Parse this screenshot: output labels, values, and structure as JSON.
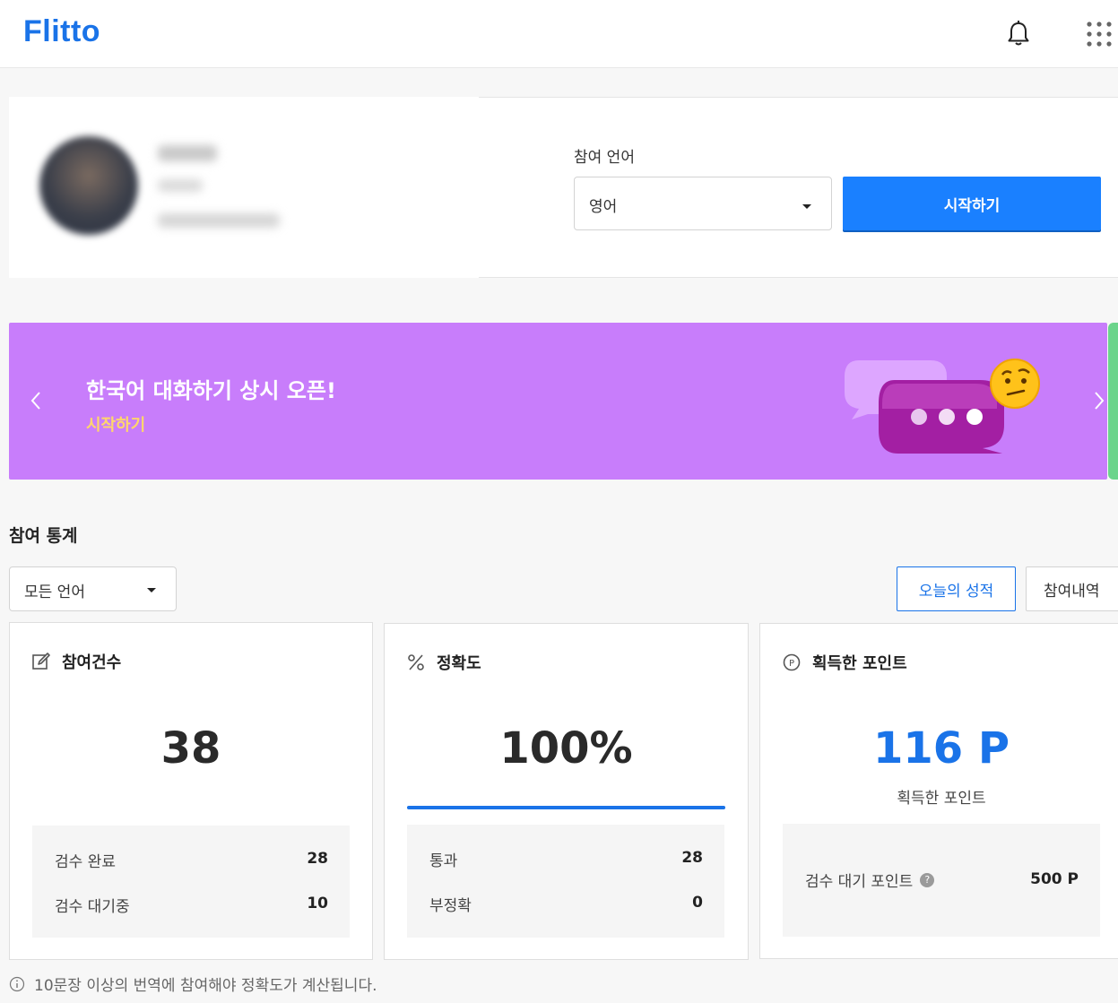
{
  "header": {
    "logo": "Flitto",
    "icons": [
      "bell-icon",
      "apps-grid-icon"
    ]
  },
  "language_panel": {
    "label": "참여 언어",
    "selected_language": "영어",
    "start_button": "시작하기"
  },
  "banner": {
    "title": "한국어 대화하기 상시 오픈!",
    "link": "시작하기",
    "background_color": "#c87dfb",
    "link_color": "#ffd66b"
  },
  "stats": {
    "section_title": "참여 통계",
    "language_filter": "모든 언어",
    "tabs": {
      "today": "오늘의 성적",
      "history": "참여내역"
    },
    "participation": {
      "title": "참여건수",
      "value": "38",
      "rows": [
        {
          "label": "검수 완료",
          "value": "28"
        },
        {
          "label": "검수 대기중",
          "value": "10"
        }
      ]
    },
    "accuracy": {
      "title": "정확도",
      "value": "100%",
      "progress_percent": 100,
      "rows": [
        {
          "label": "통과",
          "value": "28"
        },
        {
          "label": "부정확",
          "value": "0"
        }
      ]
    },
    "points": {
      "title": "획득한 포인트",
      "value": "116 P",
      "caption": "획득한 포인트",
      "pending_label": "검수 대기 포인트",
      "pending_value": "500 P"
    }
  },
  "footnote": "10문장 이상의 번역에 참여해야 정확도가 계산됩니다.",
  "colors": {
    "accent": "#1a80ff",
    "points_blue": "#1a73e8"
  }
}
